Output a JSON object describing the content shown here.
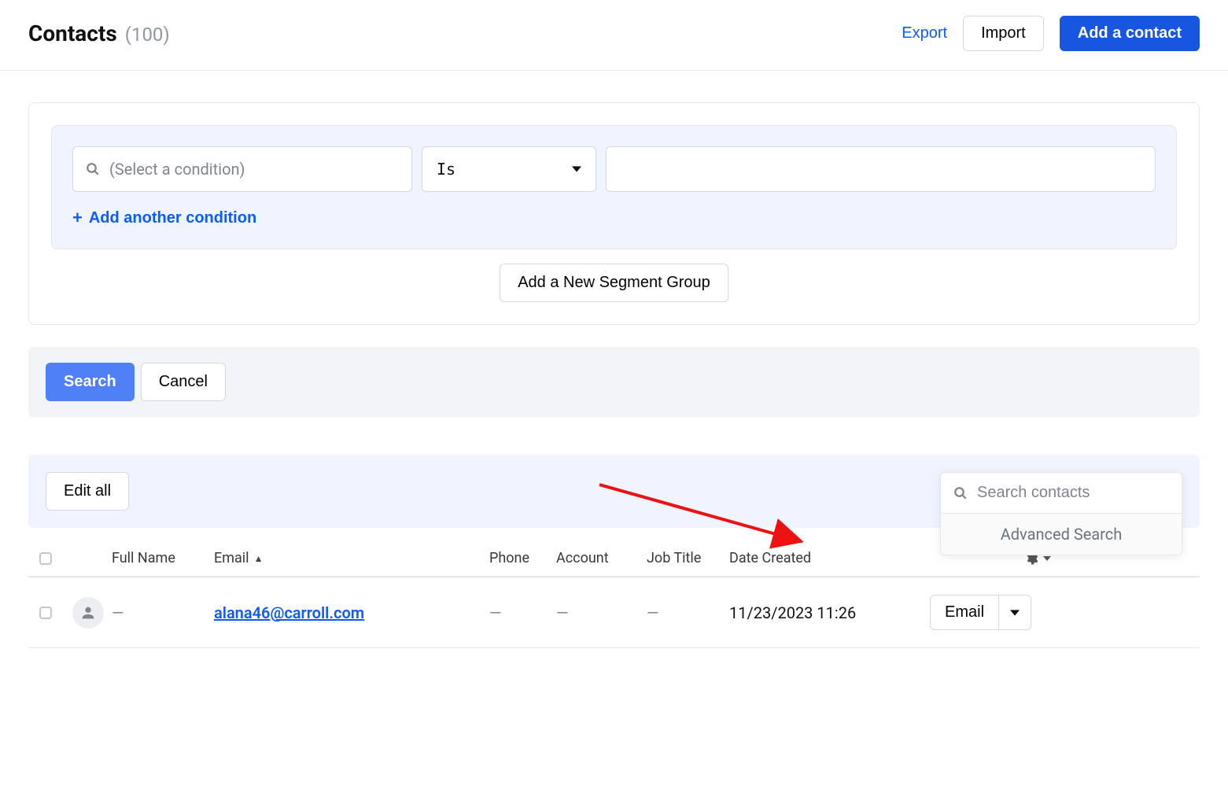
{
  "header": {
    "title": "Contacts",
    "count": "(100)",
    "export_label": "Export",
    "import_label": "Import",
    "add_label": "Add a contact"
  },
  "segment": {
    "condition_placeholder": "(Select a condition)",
    "operator_label": "Is",
    "add_condition_label": "Add another condition",
    "new_group_label": "Add a New Segment Group",
    "search_label": "Search",
    "cancel_label": "Cancel"
  },
  "table_toolbar": {
    "edit_all_label": "Edit all",
    "search_placeholder": "Search contacts",
    "advanced_search_label": "Advanced Search"
  },
  "columns": {
    "full_name": "Full Name",
    "email": "Email",
    "phone": "Phone",
    "account": "Account",
    "job_title": "Job Title",
    "date_created": "Date Created"
  },
  "rows": [
    {
      "full_name": "—",
      "email": "alana46@carroll.com",
      "phone": "—",
      "account": "—",
      "job_title": "—",
      "date_created": "11/23/2023 11:26",
      "action_label": "Email"
    }
  ]
}
